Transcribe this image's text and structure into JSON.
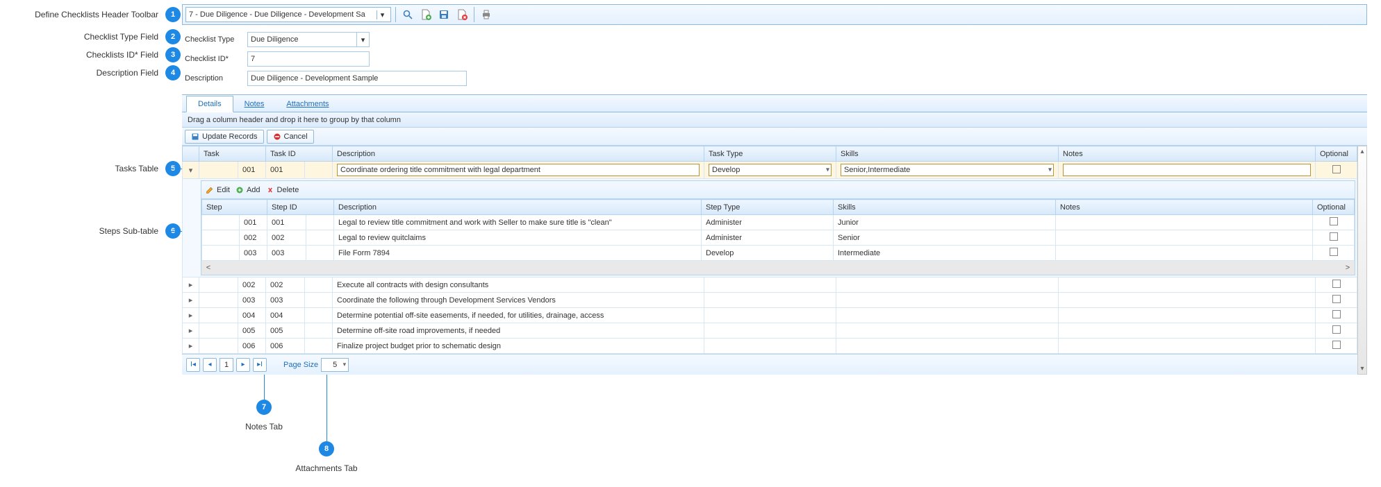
{
  "callouts": {
    "c1": "Define Checklists Header Toolbar",
    "c2": "Checklist Type Field",
    "c3": "Checklists ID* Field",
    "c4": "Description Field",
    "c5": "Tasks Table",
    "c6": "Steps Sub-table",
    "c7": "Notes Tab",
    "c8": "Attachments Tab"
  },
  "toolbar": {
    "selector_text": "7 - Due Diligence - Due Diligence - Development Sa"
  },
  "form": {
    "type_label": "Checklist Type",
    "type_value": "Due Diligence",
    "id_label": "Checklist ID*",
    "id_value": "7",
    "desc_label": "Description",
    "desc_value": "Due Diligence - Development Sample"
  },
  "tabs": {
    "details": "Details",
    "notes": "Notes",
    "attachments": "Attachments"
  },
  "group_hint": "Drag a column header and drop it here to group by that column",
  "actions": {
    "update": "Update Records",
    "cancel": "Cancel",
    "edit": "Edit",
    "add": "Add",
    "delete": "Delete"
  },
  "task_headers": {
    "task": "Task",
    "task_id": "Task ID",
    "description": "Description",
    "task_type": "Task Type",
    "skills": "Skills",
    "notes": "Notes",
    "optional": "Optional"
  },
  "step_headers": {
    "step": "Step",
    "step_id": "Step ID",
    "description": "Description",
    "step_type": "Step Type",
    "skills": "Skills",
    "notes": "Notes",
    "optional": "Optional"
  },
  "edit_task": {
    "task": "001",
    "task_id": "001",
    "description": "Coordinate ordering title commitment with legal department",
    "task_type": "Develop",
    "skills": "Senior,Intermediate",
    "notes": ""
  },
  "steps": [
    {
      "step": "001",
      "step_id": "001",
      "description": "Legal to review title commitment and work with Seller to make sure title is \"clean\"",
      "step_type": "Administer",
      "skills": "Junior",
      "notes": ""
    },
    {
      "step": "002",
      "step_id": "002",
      "description": "Legal to review quitclaims",
      "step_type": "Administer",
      "skills": "Senior",
      "notes": ""
    },
    {
      "step": "003",
      "step_id": "003",
      "description": "File Form 7894",
      "step_type": "Develop",
      "skills": "Intermediate",
      "notes": ""
    }
  ],
  "tasks_rest": [
    {
      "task": "002",
      "task_id": "002",
      "description": "Execute all contracts with design consultants"
    },
    {
      "task": "003",
      "task_id": "003",
      "description": "Coordinate the following through Development Services Vendors"
    },
    {
      "task": "004",
      "task_id": "004",
      "description": "Determine potential off-site easements, if needed, for utilities, drainage, access"
    },
    {
      "task": "005",
      "task_id": "005",
      "description": "Determine off-site road improvements, if needed"
    },
    {
      "task": "006",
      "task_id": "006",
      "description": "Finalize project budget prior to schematic design"
    }
  ],
  "pager": {
    "page": "1",
    "size_label": "Page Size",
    "size": "5"
  }
}
